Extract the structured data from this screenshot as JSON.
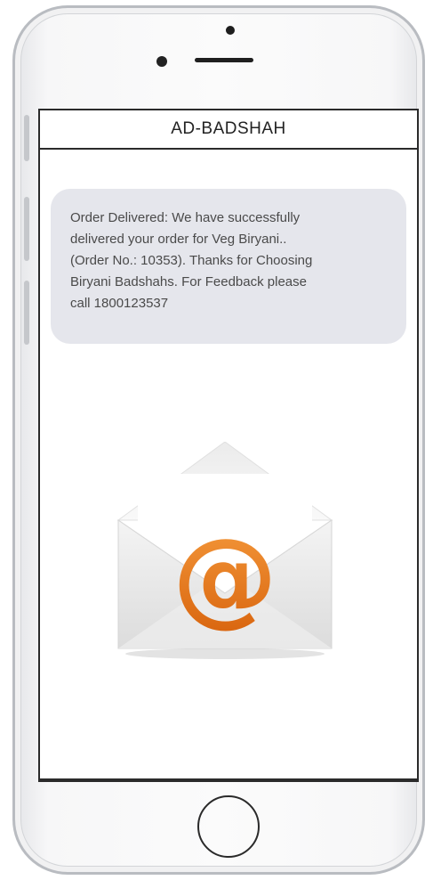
{
  "header": {
    "sender": "AD-BADSHAH"
  },
  "message": {
    "lines": [
      "Order Delivered: We have successfully",
      "delivered your order for Veg Biryani..",
      "(Order No.: 10353). Thanks for Choosing",
      "Biryani Badshahs. For Feedback please",
      "call 1800123537"
    ]
  },
  "illustration": {
    "icon": "email-envelope-icon",
    "at_symbol": "@",
    "accent_color": "#e8731a"
  },
  "colors": {
    "bubble_bg": "#e5e6ec",
    "text": "#4a4a4a",
    "frame": "#b9bcc1"
  }
}
